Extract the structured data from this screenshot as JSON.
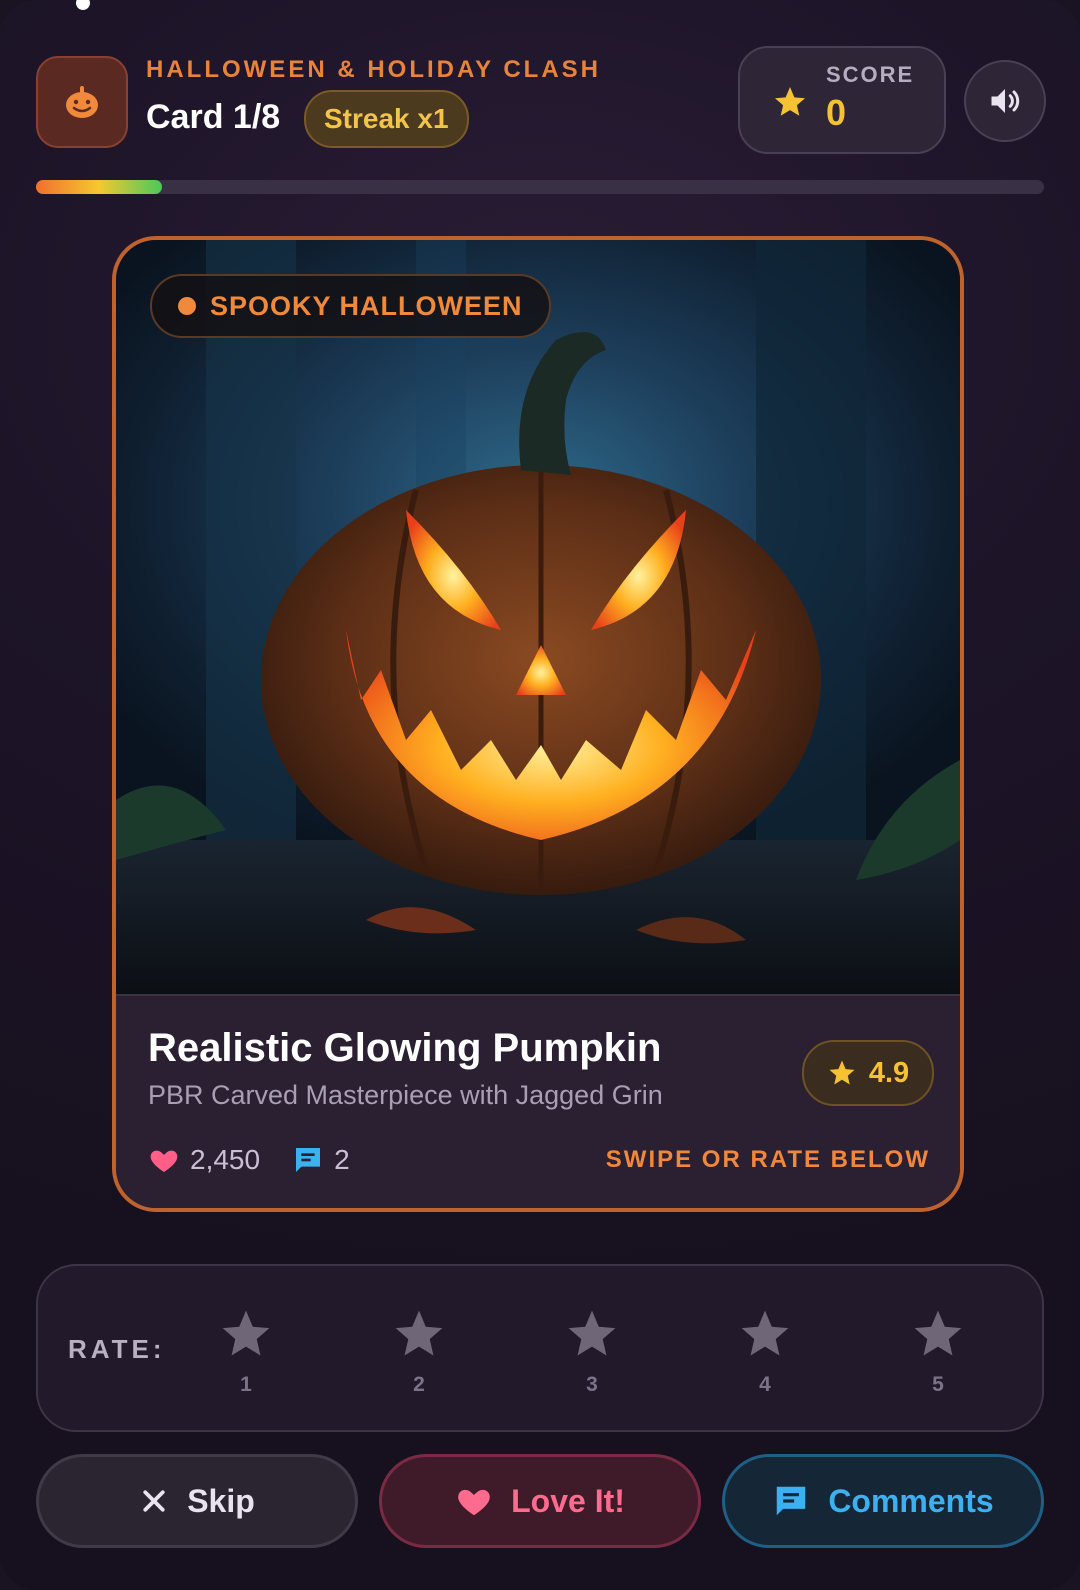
{
  "header": {
    "subtitle": "HALLOWEEN & HOLIDAY CLASH",
    "card_counter": "Card 1/8",
    "streak": "Streak x1",
    "score_label": "SCORE",
    "score_value": "0"
  },
  "progress": {
    "current": 1,
    "total": 8,
    "fraction": 0.125
  },
  "card": {
    "category": "SPOOKY HALLOWEEN",
    "title": "Realistic Glowing Pumpkin",
    "description": "PBR Carved Masterpiece with Jagged Grin",
    "rating": "4.9",
    "likes": "2,450",
    "comments": "2",
    "hint": "SWIPE OR RATE BELOW"
  },
  "rate": {
    "label": "RATE:",
    "stars": [
      "1",
      "2",
      "3",
      "4",
      "5"
    ]
  },
  "actions": {
    "skip": "Skip",
    "love": "Love It!",
    "comments": "Comments"
  },
  "icons": {
    "app": "pumpkin-icon",
    "score": "star-icon",
    "sound": "speaker-icon",
    "likes": "heart-icon",
    "comments": "chat-bubble-icon",
    "skip": "close-icon"
  },
  "colors": {
    "accent_orange": "#e8833a",
    "gold": "#f6c233",
    "love_pink": "#ff6b8e",
    "comments_blue": "#3db0ef",
    "card_border": "#c0622c"
  }
}
